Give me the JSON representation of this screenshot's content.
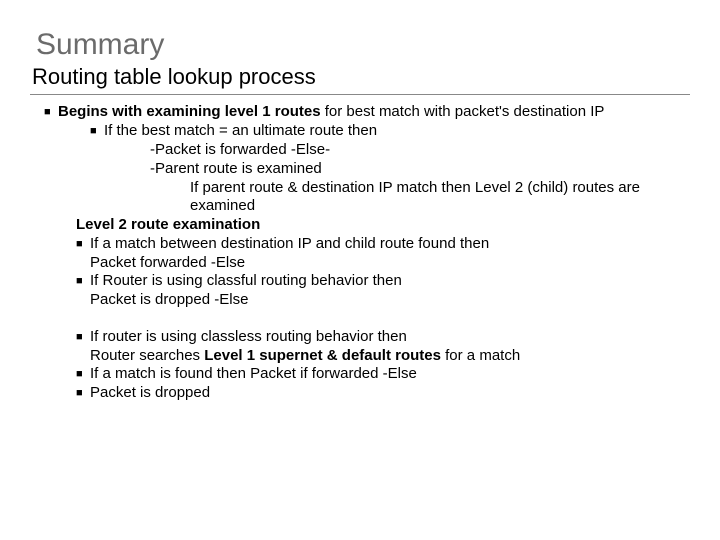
{
  "title": "Summary",
  "subtitle": "Routing table lookup process",
  "l0": {
    "a": "Begins with examining level 1 routes",
    "b": " for best match with packet's destination IP"
  },
  "l1a": "If the best match = an ultimate route then",
  "l2a": "-Packet is forwarded  -Else-",
  "l2b": "-Parent route is examined",
  "l3a": "If parent route & destination IP match then Level 2 (child) routes are examined",
  "l1b": "Level 2 route examination",
  "l1c1": "If a match between destination IP and child route found then",
  "l1c2": "Packet forwarded -Else",
  "l1d1": "If Router is using classful routing behavior then",
  "l1d2": "Packet is dropped -Else",
  "l1e1": "If router is using classless routing behavior then",
  "l1e2a": "Router searches ",
  "l1e2b": "Level 1 supernet & default routes",
  "l1e2c": " for a match",
  "l1f": "If a match is found then Packet if forwarded -Else",
  "l1g": "Packet is dropped"
}
